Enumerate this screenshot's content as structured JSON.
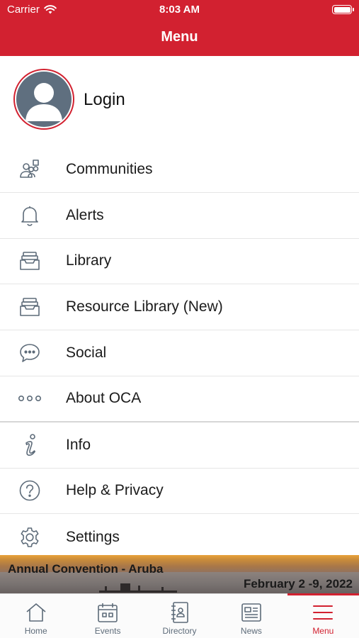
{
  "status_bar": {
    "carrier": "Carrier",
    "time": "8:03 AM"
  },
  "header": {
    "title": "Menu",
    "color": "#d22130"
  },
  "login": {
    "label": "Login"
  },
  "menu": {
    "items": [
      {
        "label": "Communities",
        "icon": "communities-icon"
      },
      {
        "label": "Alerts",
        "icon": "bell-icon"
      },
      {
        "label": "Library",
        "icon": "tray-icon"
      },
      {
        "label": "Resource Library (New)",
        "icon": "tray-icon"
      },
      {
        "label": "Social",
        "icon": "chat-bubble-icon"
      },
      {
        "label": "About OCA",
        "icon": "ellipsis-icon"
      },
      {
        "label": "Info",
        "icon": "info-icon"
      },
      {
        "label": "Help & Privacy",
        "icon": "question-icon"
      },
      {
        "label": "Settings",
        "icon": "gear-icon"
      }
    ]
  },
  "banner": {
    "title": "Annual Convention - Aruba",
    "dates": "February 2 -9, 2022"
  },
  "tabs": [
    {
      "label": "Home",
      "icon": "home-icon"
    },
    {
      "label": "Events",
      "icon": "calendar-icon"
    },
    {
      "label": "Directory",
      "icon": "contact-book-icon"
    },
    {
      "label": "News",
      "icon": "newspaper-icon"
    },
    {
      "label": "Menu",
      "icon": "hamburger-icon",
      "active": true
    }
  ]
}
